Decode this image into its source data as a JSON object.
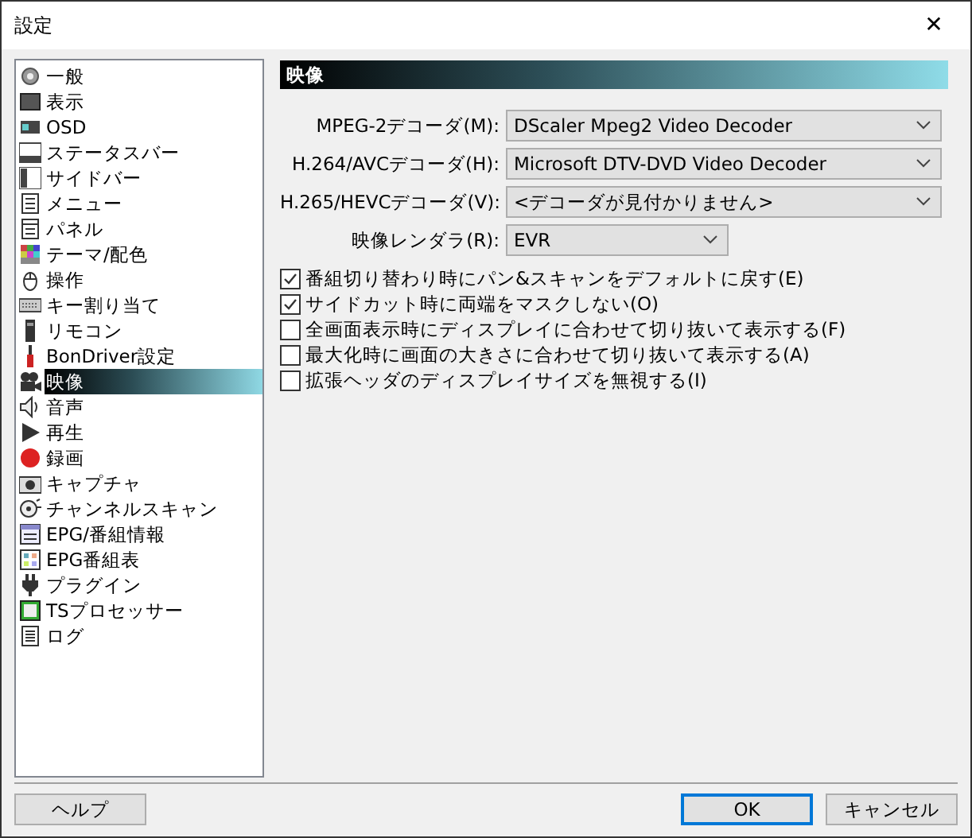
{
  "window": {
    "title": "設定",
    "close": "✕"
  },
  "sidebar": {
    "items": [
      {
        "label": "一般",
        "selected": false
      },
      {
        "label": "表示",
        "selected": false
      },
      {
        "label": "OSD",
        "selected": false
      },
      {
        "label": "ステータスバー",
        "selected": false
      },
      {
        "label": "サイドバー",
        "selected": false
      },
      {
        "label": "メニュー",
        "selected": false
      },
      {
        "label": "パネル",
        "selected": false
      },
      {
        "label": "テーマ/配色",
        "selected": false
      },
      {
        "label": "操作",
        "selected": false
      },
      {
        "label": "キー割り当て",
        "selected": false
      },
      {
        "label": "リモコン",
        "selected": false
      },
      {
        "label": "BonDriver設定",
        "selected": false
      },
      {
        "label": "映像",
        "selected": true
      },
      {
        "label": "音声",
        "selected": false
      },
      {
        "label": "再生",
        "selected": false
      },
      {
        "label": "録画",
        "selected": false
      },
      {
        "label": "キャプチャ",
        "selected": false
      },
      {
        "label": "チャンネルスキャン",
        "selected": false
      },
      {
        "label": "EPG/番組情報",
        "selected": false
      },
      {
        "label": "EPG番組表",
        "selected": false
      },
      {
        "label": "プラグイン",
        "selected": false
      },
      {
        "label": "TSプロセッサー",
        "selected": false
      },
      {
        "label": "ログ",
        "selected": false
      }
    ]
  },
  "panel": {
    "title": "映像",
    "fields": [
      {
        "label": "MPEG-2デコーダ(M):",
        "value": "DScaler Mpeg2 Video Decoder",
        "wide": true
      },
      {
        "label": "H.264/AVCデコーダ(H):",
        "value": "Microsoft DTV-DVD Video Decoder",
        "wide": true
      },
      {
        "label": "H.265/HEVCデコーダ(V):",
        "value": "<デコーダが見付かりません>",
        "wide": true
      },
      {
        "label": "映像レンダラ(R):",
        "value": "EVR",
        "wide": false
      }
    ],
    "options": [
      {
        "label": "番組切り替わり時にパン&スキャンをデフォルトに戻す(E)",
        "checked": true
      },
      {
        "label": "サイドカット時に両端をマスクしない(O)",
        "checked": true
      },
      {
        "label": "全画面表示時にディスプレイに合わせて切り抜いて表示する(F)",
        "checked": false
      },
      {
        "label": "最大化時に画面の大きさに合わせて切り抜いて表示する(A)",
        "checked": false
      },
      {
        "label": "拡張ヘッダのディスプレイサイズを無視する(I)",
        "checked": false
      }
    ]
  },
  "buttons": [
    {
      "label": "ヘルプ",
      "default": false
    },
    {
      "label": "OK",
      "default": true
    },
    {
      "label": "キャンセル",
      "default": false
    }
  ]
}
